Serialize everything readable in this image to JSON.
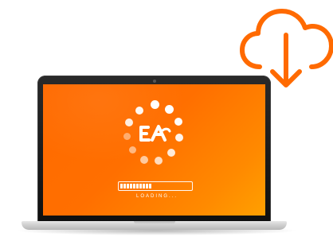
{
  "colors": {
    "accent": "#ff6a00",
    "accent_light": "#ffa000",
    "white": "#ffffff"
  },
  "icons": {
    "cloud": "cloud-download-icon",
    "logo": "app-logo-icon",
    "spinner": "loading-spinner-icon"
  },
  "screen": {
    "loading_text": "LOADING...",
    "progress_percent": 45
  }
}
